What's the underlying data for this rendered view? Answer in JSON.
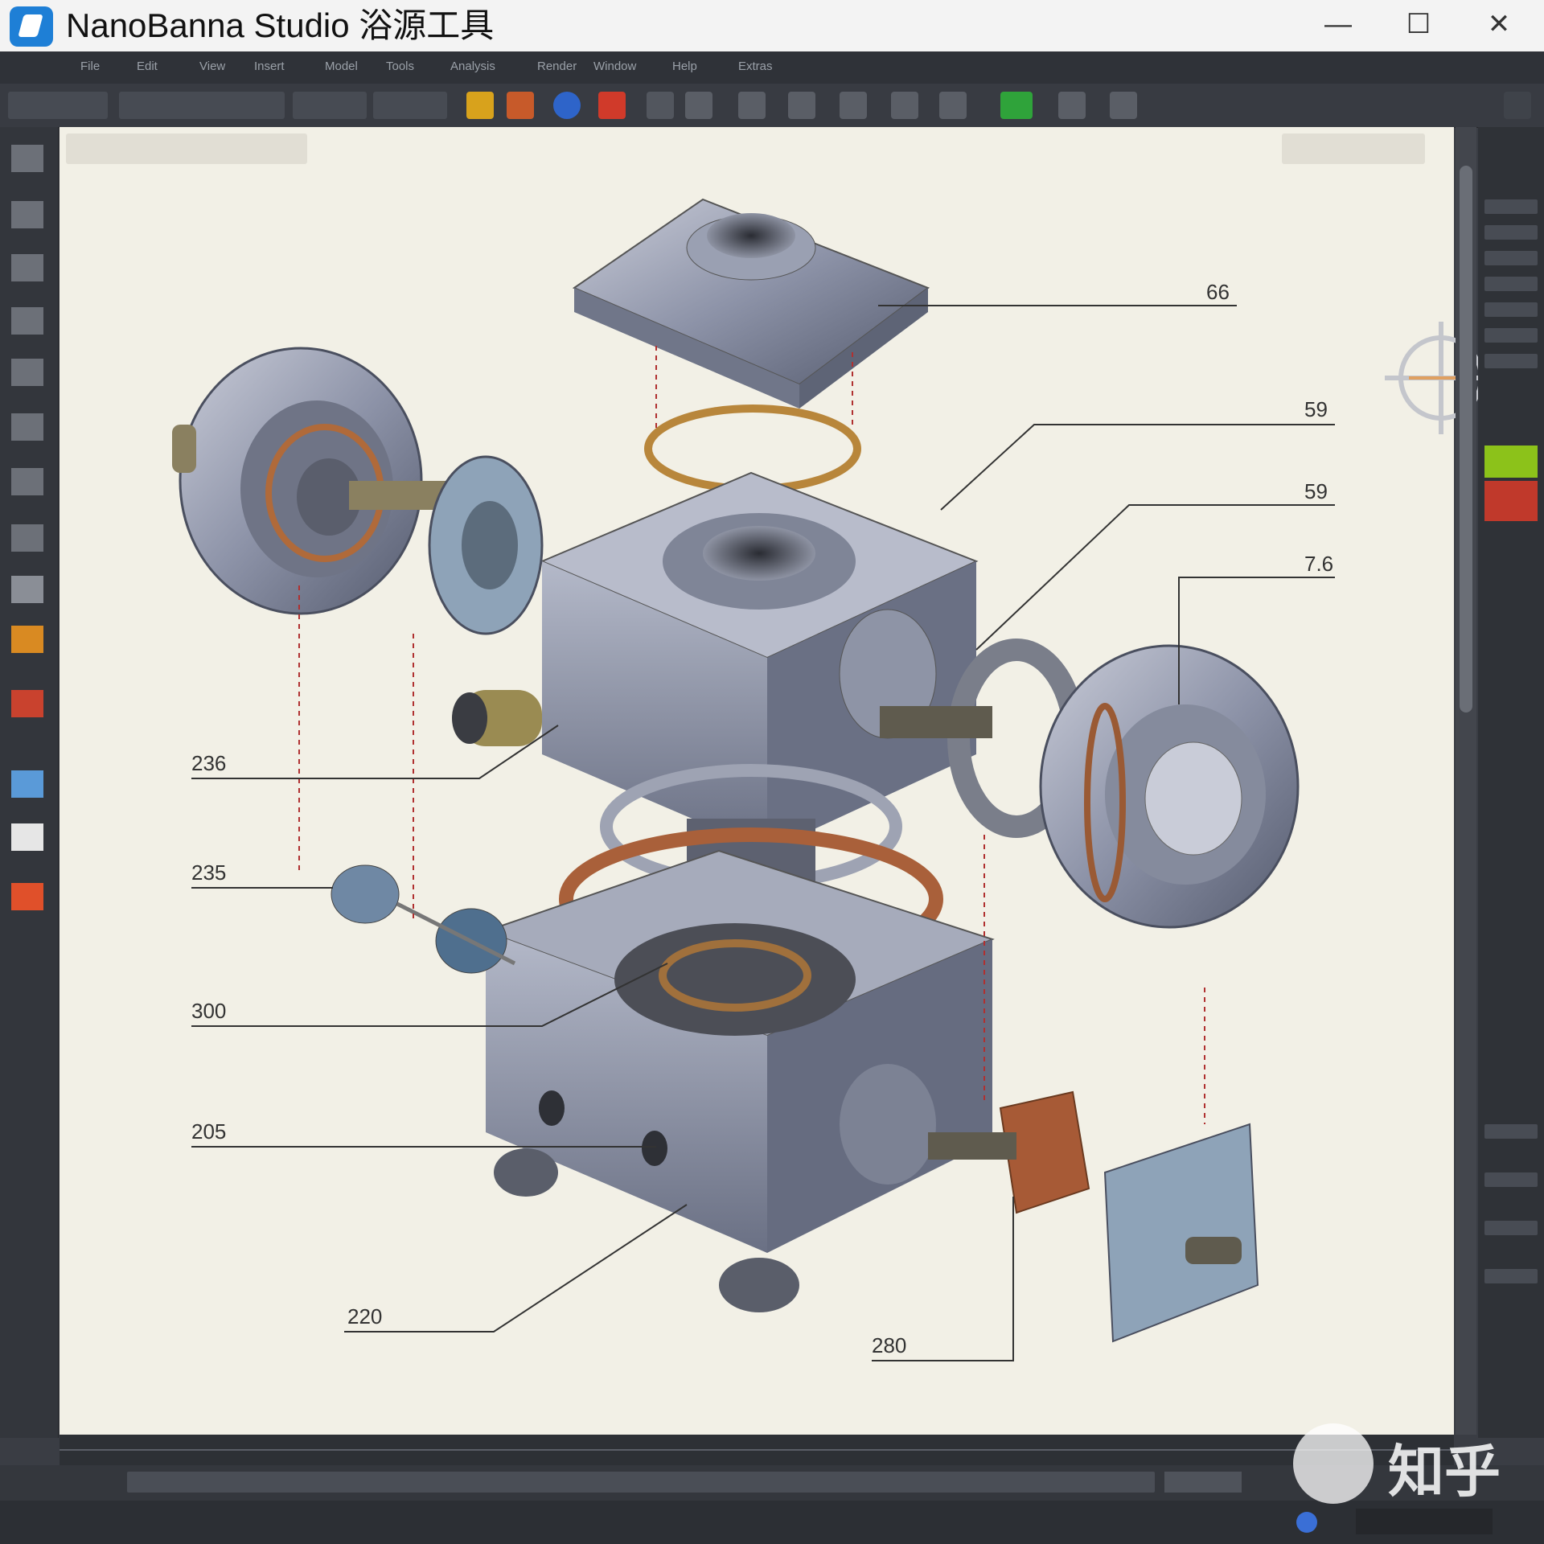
{
  "window": {
    "title": "NanoBanna Studio 浴源工具",
    "minimize_glyph": "—",
    "maximize_glyph": "☐",
    "close_glyph": "✕"
  },
  "menu": {
    "items": [
      "File",
      "Edit",
      "View",
      "Insert",
      "Model",
      "Tools",
      "Analysis",
      "Render",
      "Window",
      "Help",
      "Extras"
    ]
  },
  "icons": {
    "app": "app-logo-icon",
    "tools_left": [
      "select-icon",
      "sketch-icon",
      "rotate-icon",
      "pencil-icon",
      "box-select-icon",
      "lasso-icon",
      "orbit-icon",
      "refresh-icon",
      "eraser-icon",
      "brush-icon",
      "measure-icon",
      "layer-icon",
      "panel-icon",
      "color-swatch-icon"
    ]
  },
  "callouts": {
    "c66": "66",
    "c59a": "59",
    "c59b": "59",
    "c76": "7.6",
    "c236": "236",
    "c235": "235",
    "c300": "300",
    "c205": "205",
    "c220": "220",
    "c280": "280"
  },
  "watermark": {
    "text": "知乎"
  },
  "colors": {
    "accent_green": "#8cc21a",
    "accent_red": "#c0392b",
    "canvas_bg": "#f2f0e6"
  }
}
